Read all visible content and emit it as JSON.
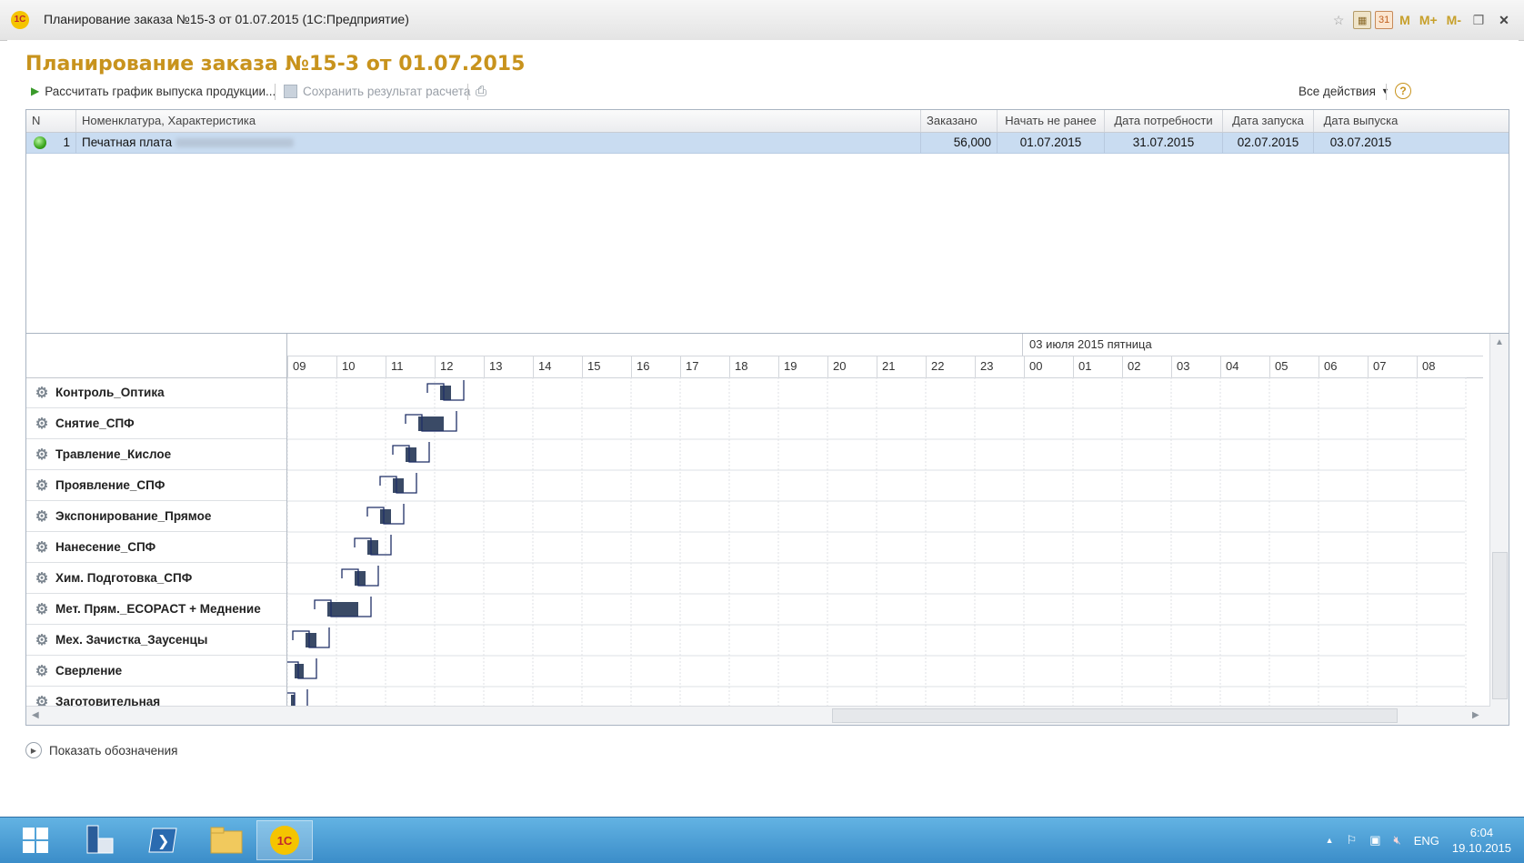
{
  "window": {
    "title": "Планирование заказа №15-3   от 01.07.2015  (1С:Предприятие)",
    "app_icon_text": "1С",
    "title_icons": [
      "star-icon",
      "calculator-icon",
      "calendar-icon",
      "M",
      "M+",
      "M-",
      "restore-icon",
      "close-icon"
    ],
    "calendar_number": "31",
    "m_labels": [
      "M",
      "M+",
      "M-"
    ]
  },
  "page": {
    "title": "Планирование заказа №15-3    от 01.07.2015"
  },
  "toolbar": {
    "calculate_label": "Рассчитать график выпуска продукции...",
    "save_label": "Сохранить результат расчета",
    "all_actions_label": "Все действия",
    "help_symbol": "?"
  },
  "orders": {
    "columns": [
      "N",
      "Номенклатура, Характеристика",
      "Заказано",
      "Начать не ранее",
      "Дата потребности",
      "Дата запуска",
      "Дата выпуска"
    ],
    "rows": [
      {
        "n": "1",
        "item": "Печатная плата",
        "ordered": "56,000",
        "start_not_before": "01.07.2015",
        "need_date": "31.07.2015",
        "launch_date": "02.07.2015",
        "release_date": "03.07.2015",
        "status_color": "#3aa61e"
      }
    ]
  },
  "gantt": {
    "date_label": "03 июля 2015 пятница",
    "hours": [
      "09",
      "10",
      "11",
      "12",
      "13",
      "14",
      "15",
      "16",
      "17",
      "18",
      "19",
      "20",
      "21",
      "22",
      "23",
      "00",
      "01",
      "02",
      "03",
      "04",
      "05",
      "06",
      "07",
      "08"
    ],
    "resources": [
      "Контроль_Оптика",
      "Снятие_СПФ",
      "Травление_Кислое",
      "Проявление_СПФ",
      "Экспонирование_Прямое",
      "Нанесение_СПФ",
      "Хим. Подготовка_СПФ",
      "Мет. Прям._ECOPACT + Меднение",
      "Мех. Зачистка_Заусенцы",
      "Сверление",
      "Заготовительная"
    ]
  },
  "legend": {
    "label": "Показать обозначения"
  },
  "taskbar": {
    "lang": "ENG",
    "time": "6:04",
    "date": "19.10.2015",
    "oneс_label": "1С"
  },
  "colors": {
    "title_accent": "#c8931d",
    "selected_row": "#c9dcf1",
    "taskbar": "#4a9fd6",
    "gantt_bar": "#3a4a66"
  }
}
